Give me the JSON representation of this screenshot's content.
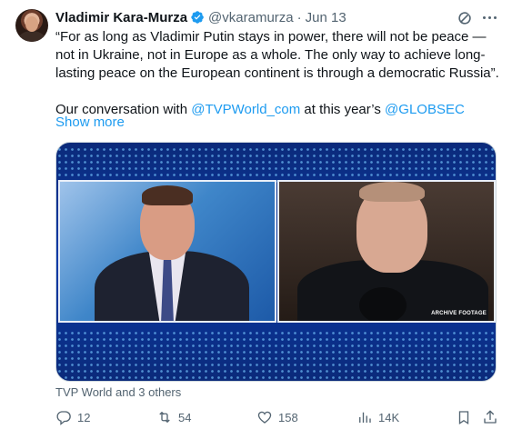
{
  "author": {
    "name": "Vladimir Kara-Murza",
    "handle": "@vkaramurza",
    "separator": "·",
    "time": "Jun 13"
  },
  "tweet": {
    "quote_text": "“For as long as Vladimir Putin stays in power, there will not be peace — not in Ukraine, not in Europe as a whole. The only way to achieve long-lasting peace on the European continent is through a democratic Russia”.",
    "second_prefix": "Our conversation with ",
    "mention1": "@TVPWorld_com",
    "second_middle": " at this year’s ",
    "mention2": "@GLOBSEC",
    "show_more": "Show more"
  },
  "media": {
    "overlay_text": "ARCHIVE FOOTAGE"
  },
  "liked_by": "TVP World and 3 others",
  "actions": {
    "replies": "12",
    "retweets": "54",
    "likes": "158",
    "views": "14K"
  },
  "colors": {
    "text": "#0f1419",
    "secondary": "#536471",
    "link": "#1d9bf0",
    "verified": "#1d9bf0"
  },
  "icons": [
    "verified-badge-icon",
    "grok-icon",
    "more-icon",
    "reply-icon",
    "retweet-icon",
    "like-icon",
    "views-icon",
    "bookmark-icon",
    "share-icon"
  ]
}
